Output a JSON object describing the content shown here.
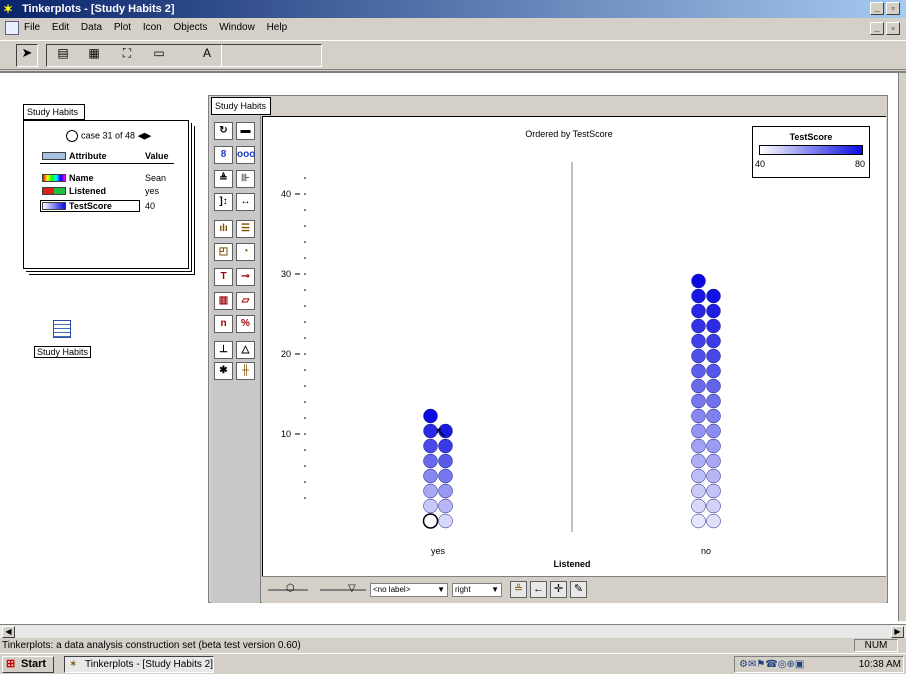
{
  "window": {
    "title": "Tinkerplots - [Study Habits 2]"
  },
  "menus": [
    "File",
    "Edit",
    "Data",
    "Plot",
    "Icon",
    "Objects",
    "Window",
    "Help"
  ],
  "card": {
    "tab_label": "Study Habits",
    "case_label": "case 31 of 48",
    "col_attribute": "Attribute",
    "col_value": "Value",
    "rows": [
      {
        "name": "Name",
        "value": "Sean"
      },
      {
        "name": "Listened",
        "value": "yes"
      },
      {
        "name": "TestScore",
        "value": "40"
      }
    ]
  },
  "table_icon": {
    "label": "Study Habits"
  },
  "plot": {
    "tab_label": "Study Habits",
    "ordered_label": "Ordered by TestScore",
    "legend": {
      "title": "TestScore",
      "min": "40",
      "max": "80",
      "color_low": "#ffffff",
      "color_high": "#0a0ae0"
    },
    "bottom": {
      "label_select": "<no label>",
      "position_select": "right"
    }
  },
  "chart_data": {
    "type": "scatter",
    "title": "Ordered by TestScore",
    "xlabel": "Listened",
    "ylabel": "",
    "categories": [
      "yes",
      "no"
    ],
    "y_ticks": [
      10,
      20,
      30,
      40
    ],
    "ylim": [
      0,
      45
    ],
    "stacks": [
      {
        "category": "yes",
        "count": 15
      },
      {
        "category": "no",
        "count": 33
      }
    ],
    "color_by": "TestScore",
    "color_range": [
      40,
      80
    ]
  },
  "status": {
    "text": "Tinkerplots: a data analysis construction set (beta test version 0.60)",
    "num": "NUM"
  },
  "taskbar": {
    "start": "Start",
    "task": "Tinkerplots - [Study Habits 2]",
    "clock": "10:38 AM"
  }
}
